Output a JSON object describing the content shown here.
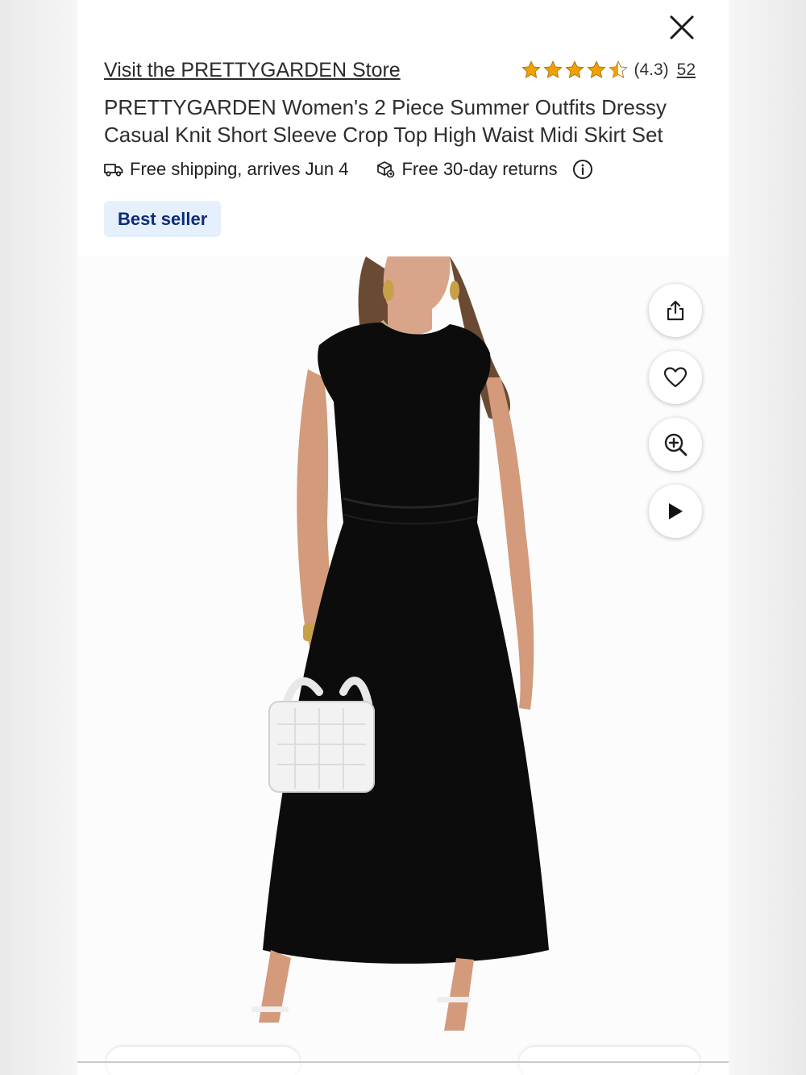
{
  "store": {
    "link_label": "Visit the PRETTYGARDEN Store"
  },
  "rating": {
    "score_text": "(4.3)",
    "value": 4.3,
    "max": 5,
    "review_count": "52",
    "star_color": "#f2a100"
  },
  "product": {
    "title": "PRETTYGARDEN Women's 2 Piece Summer Outfits Dressy Casual Knit Short Sleeve Crop Top High Waist Midi Skirt Set",
    "image_icon": "product-photo-black-dress"
  },
  "shipping": {
    "free_shipping": "Free shipping, arrives Jun 4",
    "returns": "Free 30-day returns"
  },
  "badge": {
    "label": "Best seller",
    "bg_color": "#e6f0fc",
    "text_color": "#0a2c7a"
  },
  "actions": [
    {
      "name": "share-button",
      "icon": "share-icon"
    },
    {
      "name": "favorite-button",
      "icon": "heart-icon"
    },
    {
      "name": "zoom-button",
      "icon": "zoom-in-icon"
    },
    {
      "name": "play-video-button",
      "icon": "play-icon"
    }
  ],
  "icons": {
    "close": "close-icon",
    "truck": "truck-icon",
    "returns": "returns-box-icon",
    "info": "info-icon"
  }
}
